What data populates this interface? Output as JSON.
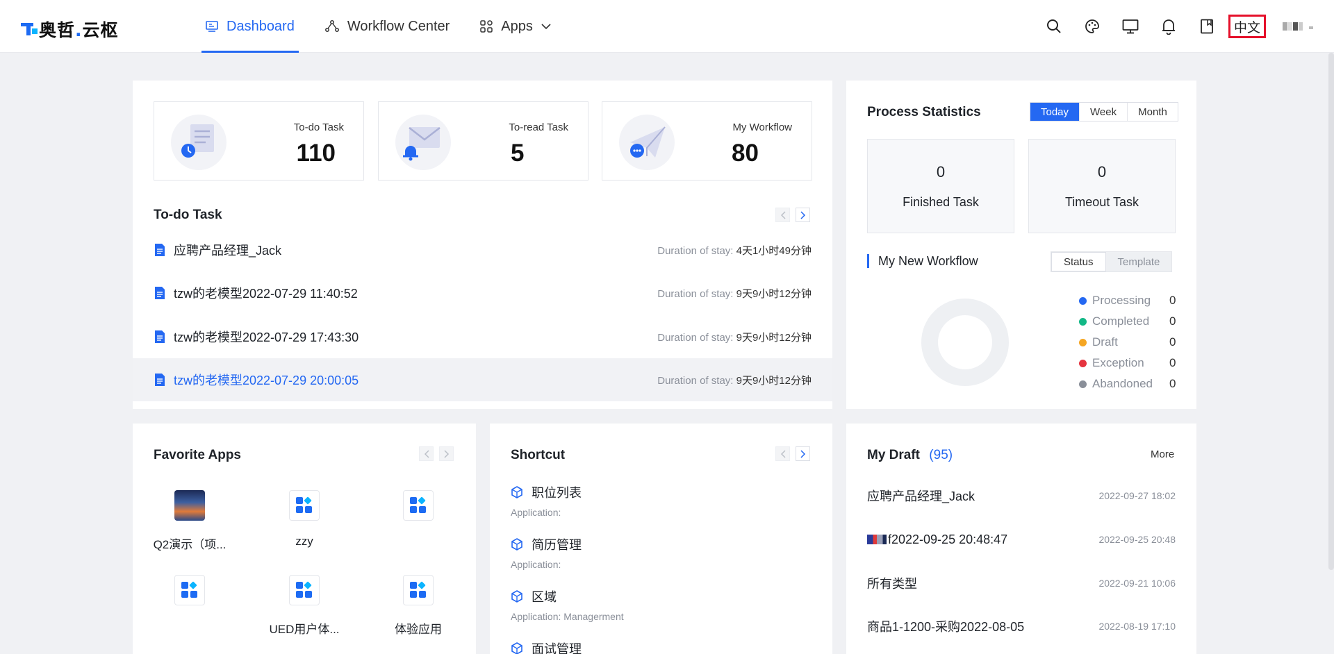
{
  "brand": {
    "name_part1": "奥哲",
    "dot": ".",
    "name_part2": "云枢"
  },
  "nav": {
    "dashboard": "Dashboard",
    "workflow_center": "Workflow Center",
    "apps": "Apps"
  },
  "header": {
    "language": "中文"
  },
  "stats": [
    {
      "label": "To-do Task",
      "value": "110"
    },
    {
      "label": "To-read Task",
      "value": "5"
    },
    {
      "label": "My Workflow",
      "value": "80"
    }
  ],
  "todo": {
    "title": "To-do Task",
    "duration_label": "Duration of stay:",
    "rows": [
      {
        "name": "应聘产品经理_Jack",
        "duration": "4天1小时49分钟"
      },
      {
        "name": "tzw的老模型2022-07-29 11:40:52",
        "duration": "9天9小时12分钟"
      },
      {
        "name": "tzw的老模型2022-07-29 17:43:30",
        "duration": "9天9小时12分钟"
      },
      {
        "name": "tzw的老模型2022-07-29 20:00:05",
        "duration": "9天9小时12分钟"
      }
    ]
  },
  "process": {
    "title": "Process Statistics",
    "tabs": [
      "Today",
      "Week",
      "Month"
    ],
    "active_tab": "Today",
    "finished": {
      "value": "0",
      "label": "Finished Task"
    },
    "timeout": {
      "value": "0",
      "label": "Timeout Task"
    },
    "new_workflow_title": "My New Workflow",
    "sub_tabs": [
      "Status",
      "Template"
    ],
    "legend": [
      {
        "label": "Processing",
        "value": "0",
        "color": "#2468f2"
      },
      {
        "label": "Completed",
        "value": "0",
        "color": "#12b886"
      },
      {
        "label": "Draft",
        "value": "0",
        "color": "#f5a623"
      },
      {
        "label": "Exception",
        "value": "0",
        "color": "#e5343f"
      },
      {
        "label": "Abandoned",
        "value": "0",
        "color": "#8a8f99"
      }
    ]
  },
  "favorites": {
    "title": "Favorite Apps",
    "apps": [
      {
        "name": "Q2演示（项..."
      },
      {
        "name": "zzy"
      },
      {
        "name": ""
      },
      {
        "name": ""
      },
      {
        "name": "UED用户体..."
      },
      {
        "name": "体验应用"
      }
    ]
  },
  "shortcut": {
    "title": "Shortcut",
    "items": [
      {
        "name": "职位列表",
        "desc": "Application:"
      },
      {
        "name": "简历管理",
        "desc": "Application:"
      },
      {
        "name": "区域",
        "desc": "Application: Managerment"
      },
      {
        "name": "面试管理",
        "desc": ""
      }
    ]
  },
  "drafts": {
    "title": "My Draft",
    "count": "(95)",
    "more": "More",
    "items": [
      {
        "name": "应聘产品经理_Jack",
        "date": "2022-09-27 18:02"
      },
      {
        "name": "f2022-09-25 20:48:47",
        "date": "2022-09-25 20:48"
      },
      {
        "name": "所有类型",
        "date": "2022-09-21 10:06"
      },
      {
        "name": "商品1-1200-采购2022-08-05",
        "date": "2022-08-19 17:10"
      }
    ]
  }
}
